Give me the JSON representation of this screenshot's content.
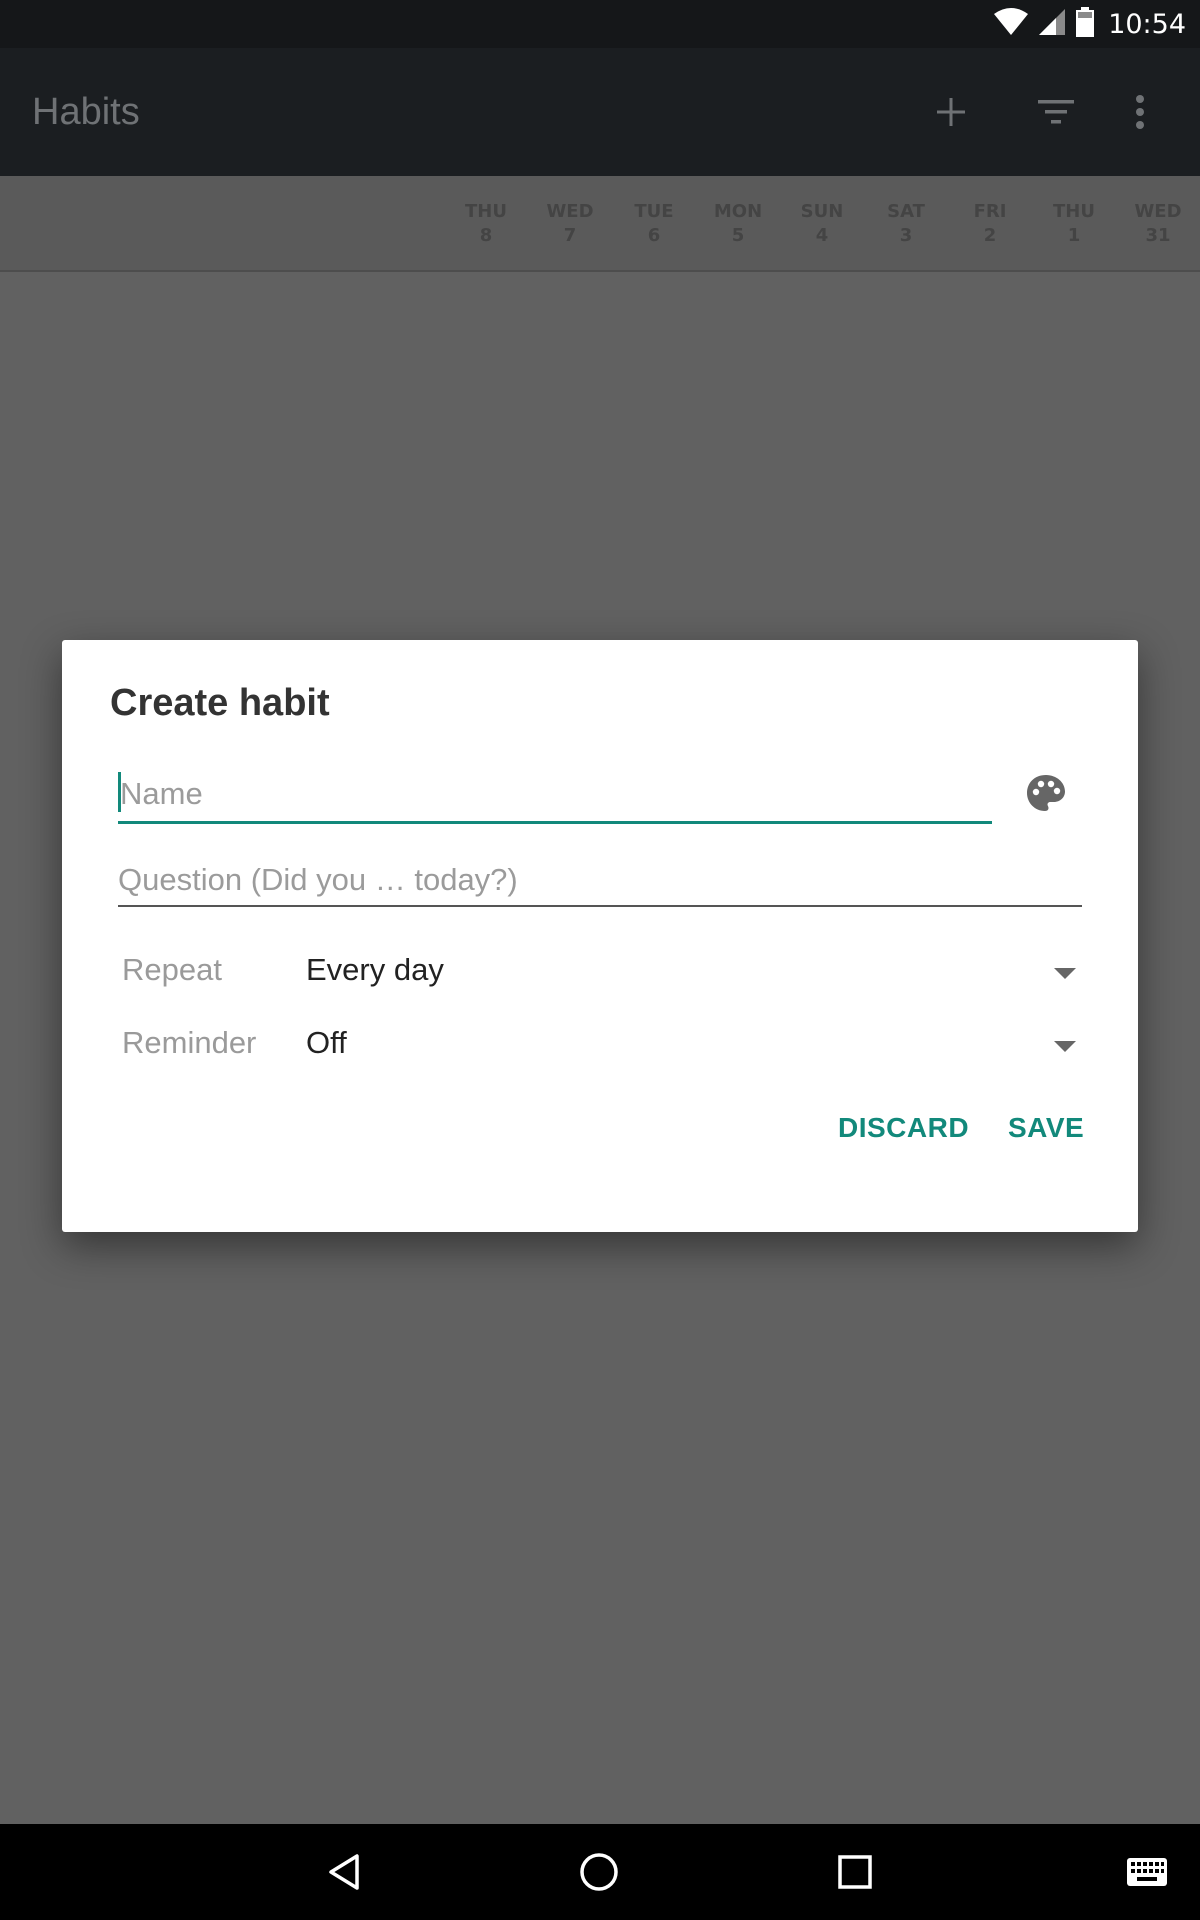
{
  "status_bar": {
    "time": "10:54",
    "icons": [
      "wifi-icon",
      "signal-icon",
      "battery-icon"
    ]
  },
  "app_bar": {
    "title": "Habits",
    "actions": [
      "add-icon",
      "filter-icon",
      "more-vert-icon"
    ]
  },
  "days": [
    {
      "day": "THU",
      "date": "8"
    },
    {
      "day": "WED",
      "date": "7"
    },
    {
      "day": "TUE",
      "date": "6"
    },
    {
      "day": "MON",
      "date": "5"
    },
    {
      "day": "SUN",
      "date": "4"
    },
    {
      "day": "SAT",
      "date": "3"
    },
    {
      "day": "FRI",
      "date": "2"
    },
    {
      "day": "THU",
      "date": "1"
    },
    {
      "day": "WED",
      "date": "31"
    }
  ],
  "dialog": {
    "title": "Create habit",
    "name": {
      "value": "",
      "placeholder": "Name"
    },
    "question": {
      "value": "",
      "placeholder": "Question (Did you … today?)"
    },
    "repeat": {
      "label": "Repeat",
      "value": "Every day"
    },
    "reminder": {
      "label": "Reminder",
      "value": "Off"
    },
    "discard_label": "DISCARD",
    "save_label": "SAVE"
  },
  "colors": {
    "accent": "#12897b",
    "app_bar": "#1b1e21",
    "status_bar": "#151719",
    "scrim": "#616161"
  },
  "nav_bar": {
    "buttons": [
      "back-icon",
      "home-icon",
      "recents-icon",
      "keyboard-icon"
    ]
  }
}
